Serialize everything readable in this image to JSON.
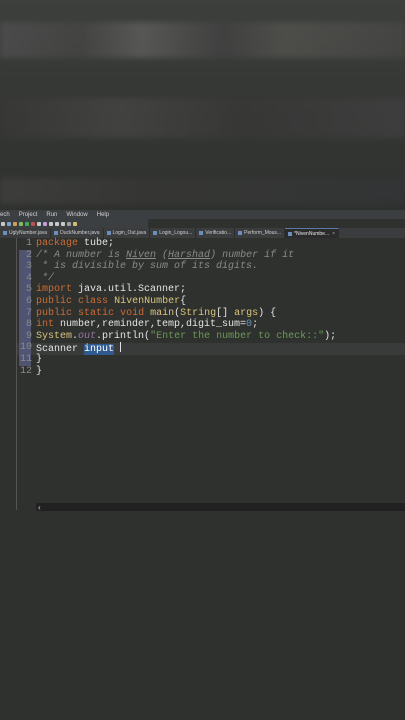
{
  "menu": {
    "items": [
      "ech",
      "Project",
      "Run",
      "Window",
      "Help"
    ]
  },
  "toolbar": {
    "icons": [
      {
        "name": "new-icon",
        "color": "#c8c8c8"
      },
      {
        "name": "save-icon",
        "color": "#7fa0d0"
      },
      {
        "name": "build-icon",
        "color": "#d0a050"
      },
      {
        "name": "debug-icon",
        "color": "#7bbf6a"
      },
      {
        "name": "run-icon",
        "color": "#4fa84f"
      },
      {
        "name": "stop-icon",
        "color": "#c05050"
      },
      {
        "name": "search-icon",
        "color": "#c8c8c8"
      },
      {
        "name": "refactor-icon",
        "color": "#c0a0d0"
      },
      {
        "name": "back-icon",
        "color": "#c8c8c8"
      },
      {
        "name": "forward-icon",
        "color": "#c8c8c8"
      },
      {
        "name": "history-icon",
        "color": "#c8c8c8"
      },
      {
        "name": "nav-icon",
        "color": "#a0a0a0"
      },
      {
        "name": "folder-icon",
        "color": "#d0c070"
      }
    ]
  },
  "tabs": [
    {
      "label": "UglyNumber.java",
      "active": false
    },
    {
      "label": "DuckNumber.java",
      "active": false
    },
    {
      "label": "Login_Out.java",
      "active": false
    },
    {
      "label": "Login_Logou...",
      "active": false
    },
    {
      "label": "Verificatio...",
      "active": false
    },
    {
      "label": "Perform_Mous...",
      "active": false
    },
    {
      "label": "*NivenNumbe...",
      "active": true
    }
  ],
  "editor": {
    "line_numbers": [
      "1",
      "2",
      "3",
      "4",
      "5",
      "6",
      "7",
      "8",
      "9",
      "10",
      "11",
      "12"
    ],
    "lines": [
      [
        {
          "t": "kw",
          "v": "package"
        },
        {
          "t": "",
          "v": " tube;"
        }
      ],
      [
        {
          "t": "cmt",
          "v": "/* A number is "
        },
        {
          "t": "cmt",
          "v": "Niven",
          "u": true
        },
        {
          "t": "cmt",
          "v": " ("
        },
        {
          "t": "cmt",
          "v": "Harshad",
          "u": true
        },
        {
          "t": "cmt",
          "v": ") number if it"
        }
      ],
      [
        {
          "t": "cmt",
          "v": " * is divisible by sum of its digits."
        }
      ],
      [
        {
          "t": "cmt",
          "v": " */"
        }
      ],
      [
        {
          "t": "kw",
          "v": "import"
        },
        {
          "t": "",
          "v": " java.util.Scanner;"
        }
      ],
      [
        {
          "t": "kw",
          "v": "public"
        },
        {
          "t": "",
          "v": " "
        },
        {
          "t": "kw",
          "v": "class"
        },
        {
          "t": "",
          "v": " "
        },
        {
          "t": "cls",
          "v": "NivenNumber"
        },
        {
          "t": "",
          "v": "{"
        }
      ],
      [
        {
          "t": "kw",
          "v": "public"
        },
        {
          "t": "",
          "v": " "
        },
        {
          "t": "kw",
          "v": "static"
        },
        {
          "t": "",
          "v": " "
        },
        {
          "t": "kw",
          "v": "void"
        },
        {
          "t": "",
          "v": " "
        },
        {
          "t": "cls",
          "v": "main"
        },
        {
          "t": "",
          "v": "("
        },
        {
          "t": "cls",
          "v": "String"
        },
        {
          "t": "",
          "v": "[] "
        },
        {
          "t": "cls",
          "v": "args"
        },
        {
          "t": "",
          "v": ") {"
        }
      ],
      [
        {
          "t": "kw",
          "v": "int"
        },
        {
          "t": "",
          "v": " number,reminder,temp,digit_sum="
        },
        {
          "t": "num",
          "v": "0"
        },
        {
          "t": "",
          "v": ";"
        }
      ],
      [
        {
          "t": "cls",
          "v": "System"
        },
        {
          "t": "",
          "v": "."
        },
        {
          "t": "fld",
          "v": "out"
        },
        {
          "t": "",
          "v": ".println("
        },
        {
          "t": "str",
          "v": "\"Enter the number to check::\""
        },
        {
          "t": "",
          "v": ");"
        }
      ],
      [
        {
          "t": "",
          "v": "Scanner "
        },
        {
          "t": "sel",
          "v": "input"
        },
        {
          "t": "",
          "v": " "
        },
        {
          "t": "caret",
          "v": ""
        }
      ],
      [
        {
          "t": "",
          "v": "}"
        }
      ],
      [
        {
          "t": "",
          "v": "}"
        }
      ]
    ]
  },
  "hscroll": {
    "arrow": "‹"
  }
}
